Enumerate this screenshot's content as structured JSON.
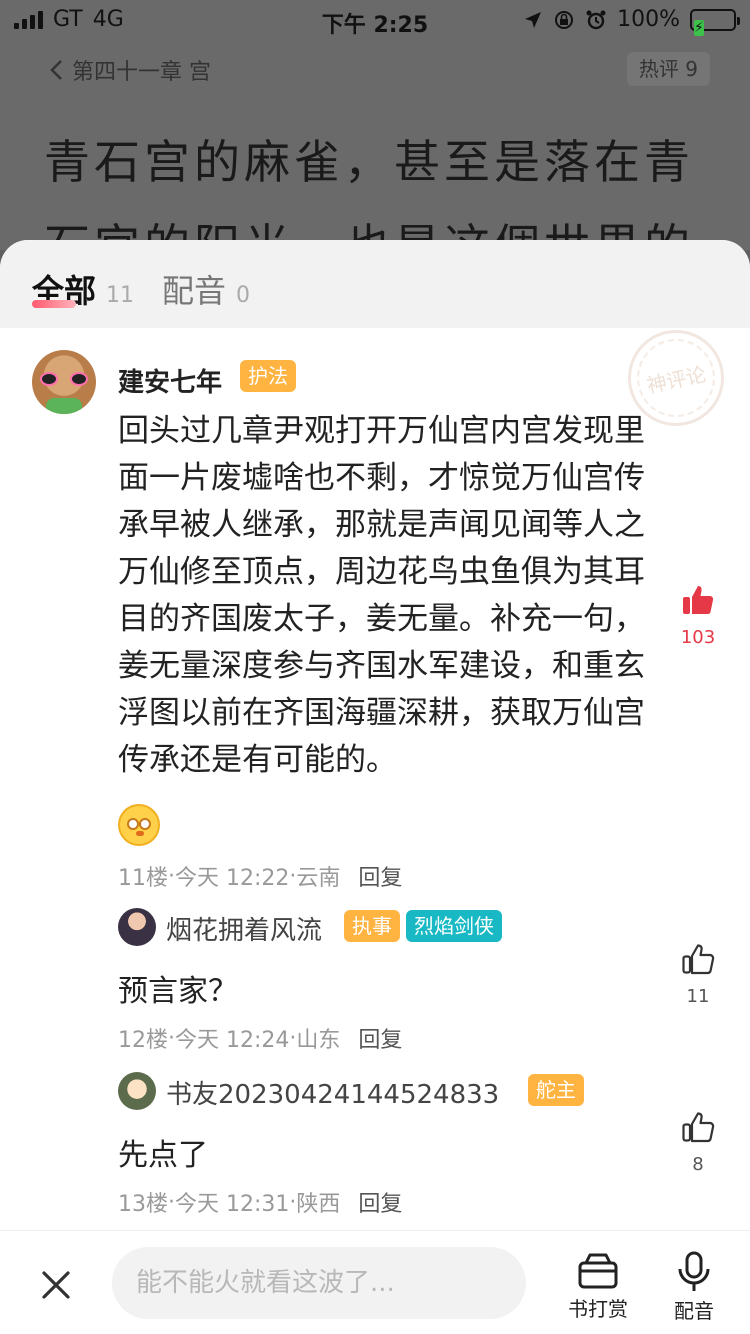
{
  "status_bar": {
    "carrier": "GT",
    "network": "4G",
    "time": "下午 2:25",
    "battery": "100%"
  },
  "reader": {
    "back_label": "第四十一章 宫",
    "hot_label": "热评 9",
    "text": "青石宫的麻雀，甚至是落在青石宫的阳光，也是这個世界的"
  },
  "tabs": [
    {
      "label": "全部",
      "count": "11"
    },
    {
      "label": "配音",
      "count": "0"
    }
  ],
  "stamp": "神评论",
  "main_comment": {
    "username": "建安七年",
    "badge": "护法",
    "body": "回头过几章尹观打开万仙宫内宫发现里面一片废墟啥也不剩，才惊觉万仙宫传承早被人继承，那就是声闻见闻等人之万仙修至顶点，周边花鸟虫鱼俱为其耳目的齐国废太子，姜无量。补充一句，姜无量深度参与齐国水军建设，和重玄浮图以前在齐国海疆深耕，获取万仙宫传承还是有可能的。",
    "floor": "11楼",
    "time": "今天 12:22",
    "location": "云南",
    "reply": "回复",
    "likes": "103"
  },
  "replies": [
    {
      "username": "烟花拥着风流",
      "badges": [
        "执事",
        "烈焰剑侠"
      ],
      "text": "预言家？",
      "floor": "12楼",
      "time": "今天 12:24",
      "location": "山东",
      "reply": "回复",
      "likes": "11"
    },
    {
      "username": "书友20230424144524833",
      "badges": [
        "舵主"
      ],
      "text": "先点了",
      "floor": "13楼",
      "time": "今天 12:31",
      "location": "陕西",
      "reply": "回复",
      "likes": "8"
    }
  ],
  "separator": " · ",
  "bottom_bar": {
    "input_placeholder": "能不能火就看这波了...",
    "reward_label": "书打赏",
    "dub_label": "配音"
  },
  "colors": {
    "like_active": "#e53947",
    "badge_orange": "#ffb341",
    "badge_teal": "#18b9c4",
    "tab_underline": "#ff5a6e"
  }
}
